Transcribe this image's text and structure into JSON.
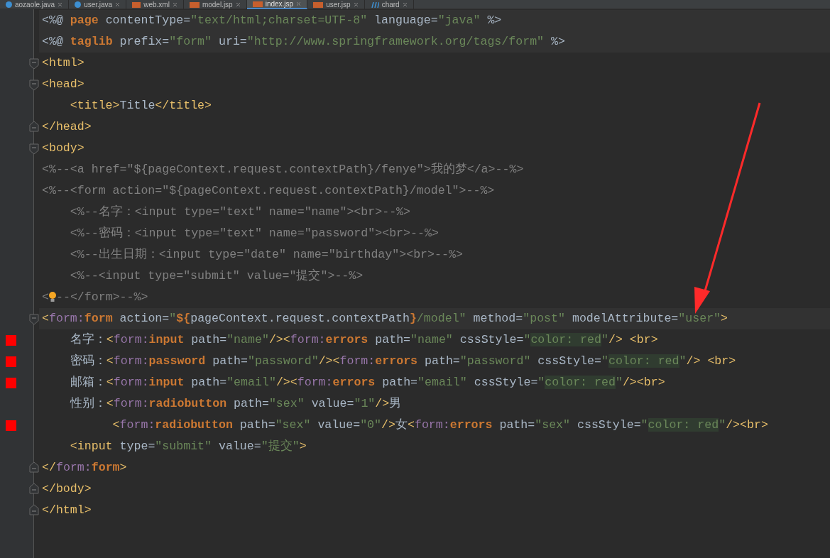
{
  "tabs": [
    {
      "label": "aozaole.java",
      "kind": "java",
      "selected": false
    },
    {
      "label": "user.java",
      "kind": "java",
      "selected": false
    },
    {
      "label": "web.xml",
      "kind": "xml",
      "selected": false
    },
    {
      "label": "model.jsp",
      "kind": "jsp",
      "selected": false
    },
    {
      "label": "index.jsp",
      "kind": "jsp",
      "selected": true
    },
    {
      "label": "user.jsp",
      "kind": "jsp",
      "selected": false
    },
    {
      "label": "chard",
      "kind": "other",
      "selected": false
    }
  ],
  "lines": [
    {
      "segments": [
        {
          "kind": "p",
          "text": "<%@ "
        },
        {
          "kind": "k",
          "text": "page"
        },
        {
          "kind": "p",
          "text": " contentType="
        },
        {
          "kind": "s",
          "text": "\"text/html;charset=UTF-8\""
        },
        {
          "kind": "p",
          "text": " language="
        },
        {
          "kind": "s",
          "text": "\"java\""
        },
        {
          "kind": "p",
          "text": " %>"
        }
      ],
      "highlighted": true,
      "error": false
    },
    {
      "segments": [
        {
          "kind": "p",
          "text": "<%@ "
        },
        {
          "kind": "k",
          "text": "taglib"
        },
        {
          "kind": "p",
          "text": " prefix="
        },
        {
          "kind": "s",
          "text": "\"form\""
        },
        {
          "kind": "p",
          "text": " uri="
        },
        {
          "kind": "s",
          "text": "\"http://www.springframework.org/tags/form\""
        },
        {
          "kind": "p",
          "text": " %>"
        }
      ],
      "highlighted": true,
      "error": false
    },
    {
      "segments": [
        {
          "kind": "t",
          "text": "<html>"
        }
      ],
      "fold_start": true,
      "highlighted": false,
      "error": false
    },
    {
      "segments": [
        {
          "kind": "t",
          "text": "<head>"
        }
      ],
      "fold_start": true,
      "highlighted": false,
      "error": false
    },
    {
      "segments": [
        {
          "kind": "t",
          "text": "    <title>"
        },
        {
          "kind": "p",
          "text": "Title"
        },
        {
          "kind": "t",
          "text": "</title>"
        }
      ],
      "highlighted": false,
      "error": false
    },
    {
      "segments": [
        {
          "kind": "t",
          "text": "</head>"
        }
      ],
      "fold_end": true,
      "highlighted": false,
      "error": false
    },
    {
      "segments": [
        {
          "kind": "t",
          "text": "<body>"
        }
      ],
      "fold_start": true,
      "highlighted": false,
      "error": false
    },
    {
      "segments": [
        {
          "kind": "c",
          "text": "<%--<a href=\"${pageContext.request.contextPath}/fenye\">我的梦</a>--%>"
        }
      ],
      "highlighted": false,
      "error": false
    },
    {
      "segments": [
        {
          "kind": "c",
          "text": "<%--<form action=\"${pageContext.request.contextPath}/model\">--%>"
        }
      ],
      "highlighted": false,
      "error": false
    },
    {
      "segments": [
        {
          "kind": "c",
          "text": "    <%--名字：<input type=\"text\" name=\"name\"><br>--%>"
        }
      ],
      "highlighted": false,
      "error": false
    },
    {
      "segments": [
        {
          "kind": "c",
          "text": "    <%--密码：<input type=\"text\" name=\"password\"><br>--%>"
        }
      ],
      "highlighted": false,
      "error": false
    },
    {
      "segments": [
        {
          "kind": "c",
          "text": "    <%--出生日期：<input type=\"date\" name=\"birthday\"><br>--%>"
        }
      ],
      "highlighted": false,
      "error": false
    },
    {
      "segments": [
        {
          "kind": "c",
          "text": "    <%--<input type=\"submit\" value=\"提交\">--%>"
        }
      ],
      "highlighted": false,
      "error": false
    },
    {
      "segments": [
        {
          "kind": "c",
          "text": "<"
        },
        {
          "kind": "bulb"
        },
        {
          "kind": "c",
          "text": "--</form>--%>"
        }
      ],
      "highlighted": false,
      "error": false
    },
    {
      "segments": [
        {
          "kind": "t",
          "text": "<"
        },
        {
          "kind": "n",
          "text": "form:"
        },
        {
          "kind": "k",
          "text": "form"
        },
        {
          "kind": "p",
          "text": " action="
        },
        {
          "kind": "s",
          "text": "\""
        },
        {
          "kind": "k",
          "text": "${"
        },
        {
          "kind": "p",
          "text": "pageContext.request.contextPath"
        },
        {
          "kind": "k",
          "text": "}"
        },
        {
          "kind": "s",
          "text": "/model\""
        },
        {
          "kind": "p",
          "text": " method="
        },
        {
          "kind": "s",
          "text": "\"post\""
        },
        {
          "kind": "p",
          "text": " modelAttribute="
        },
        {
          "kind": "s",
          "text": "\"user\""
        },
        {
          "kind": "t",
          "text": ">"
        }
      ],
      "fold_start": true,
      "highlighted": true,
      "error": false
    },
    {
      "segments": [
        {
          "kind": "p",
          "text": "    名字："
        },
        {
          "kind": "t",
          "text": "<"
        },
        {
          "kind": "n",
          "text": "form:"
        },
        {
          "kind": "k",
          "text": "input"
        },
        {
          "kind": "p",
          "text": " path="
        },
        {
          "kind": "s",
          "text": "\"name\""
        },
        {
          "kind": "t",
          "text": "/><"
        },
        {
          "kind": "n",
          "text": "form:"
        },
        {
          "kind": "k",
          "text": "errors"
        },
        {
          "kind": "p",
          "text": " path="
        },
        {
          "kind": "s",
          "text": "\"name\""
        },
        {
          "kind": "p",
          "text": " cssStyle="
        },
        {
          "kind": "s",
          "text": "\""
        },
        {
          "kind": "i",
          "text": "color: red"
        },
        {
          "kind": "s",
          "text": "\""
        },
        {
          "kind": "t",
          "text": "/> <br>"
        }
      ],
      "highlighted": false,
      "error": true
    },
    {
      "segments": [
        {
          "kind": "p",
          "text": "    密码："
        },
        {
          "kind": "t",
          "text": "<"
        },
        {
          "kind": "n",
          "text": "form:"
        },
        {
          "kind": "k",
          "text": "password"
        },
        {
          "kind": "p",
          "text": " path="
        },
        {
          "kind": "s",
          "text": "\"password\""
        },
        {
          "kind": "t",
          "text": "/><"
        },
        {
          "kind": "n",
          "text": "form:"
        },
        {
          "kind": "k",
          "text": "errors"
        },
        {
          "kind": "p",
          "text": " path="
        },
        {
          "kind": "s",
          "text": "\"password\""
        },
        {
          "kind": "p",
          "text": " cssStyle="
        },
        {
          "kind": "s",
          "text": "\""
        },
        {
          "kind": "i",
          "text": "color: red"
        },
        {
          "kind": "s",
          "text": "\""
        },
        {
          "kind": "t",
          "text": "/> <br>"
        }
      ],
      "highlighted": false,
      "error": true
    },
    {
      "segments": [
        {
          "kind": "p",
          "text": "    邮箱："
        },
        {
          "kind": "t",
          "text": "<"
        },
        {
          "kind": "n",
          "text": "form:"
        },
        {
          "kind": "k",
          "text": "input"
        },
        {
          "kind": "p",
          "text": " path="
        },
        {
          "kind": "s",
          "text": "\"email\""
        },
        {
          "kind": "t",
          "text": "/><"
        },
        {
          "kind": "n",
          "text": "form:"
        },
        {
          "kind": "k",
          "text": "errors"
        },
        {
          "kind": "p",
          "text": " path="
        },
        {
          "kind": "s",
          "text": "\"email\""
        },
        {
          "kind": "p",
          "text": " cssStyle="
        },
        {
          "kind": "s",
          "text": "\""
        },
        {
          "kind": "i",
          "text": "color: red"
        },
        {
          "kind": "s",
          "text": "\""
        },
        {
          "kind": "t",
          "text": "/><br>"
        }
      ],
      "highlighted": false,
      "error": true
    },
    {
      "segments": [
        {
          "kind": "p",
          "text": "    性别："
        },
        {
          "kind": "t",
          "text": "<"
        },
        {
          "kind": "n",
          "text": "form:"
        },
        {
          "kind": "k",
          "text": "radiobutton"
        },
        {
          "kind": "p",
          "text": " path="
        },
        {
          "kind": "s",
          "text": "\"sex\""
        },
        {
          "kind": "p",
          "text": " value="
        },
        {
          "kind": "s",
          "text": "\"1\""
        },
        {
          "kind": "t",
          "text": "/>"
        },
        {
          "kind": "p",
          "text": "男"
        }
      ],
      "highlighted": false,
      "error": false
    },
    {
      "segments": [
        {
          "kind": "t",
          "text": "          <"
        },
        {
          "kind": "n",
          "text": "form:"
        },
        {
          "kind": "k",
          "text": "radiobutton"
        },
        {
          "kind": "p",
          "text": " path="
        },
        {
          "kind": "s",
          "text": "\"sex\""
        },
        {
          "kind": "p",
          "text": " value="
        },
        {
          "kind": "s",
          "text": "\"0\""
        },
        {
          "kind": "t",
          "text": "/>"
        },
        {
          "kind": "p",
          "text": "女"
        },
        {
          "kind": "t",
          "text": "<"
        },
        {
          "kind": "n",
          "text": "form:"
        },
        {
          "kind": "k",
          "text": "errors"
        },
        {
          "kind": "p",
          "text": " path="
        },
        {
          "kind": "s",
          "text": "\"sex\""
        },
        {
          "kind": "p",
          "text": " cssStyle="
        },
        {
          "kind": "s",
          "text": "\""
        },
        {
          "kind": "i",
          "text": "color: red"
        },
        {
          "kind": "s",
          "text": "\""
        },
        {
          "kind": "t",
          "text": "/><br>"
        }
      ],
      "highlighted": false,
      "error": true
    },
    {
      "segments": [
        {
          "kind": "t",
          "text": "    <input"
        },
        {
          "kind": "p",
          "text": " type="
        },
        {
          "kind": "s",
          "text": "\"submit\""
        },
        {
          "kind": "p",
          "text": " value="
        },
        {
          "kind": "s",
          "text": "\"提交\""
        },
        {
          "kind": "t",
          "text": ">"
        }
      ],
      "highlighted": false,
      "error": false
    },
    {
      "segments": [
        {
          "kind": "t",
          "text": "</"
        },
        {
          "kind": "n",
          "text": "form:"
        },
        {
          "kind": "k",
          "text": "form"
        },
        {
          "kind": "t",
          "text": ">"
        }
      ],
      "fold_end": true,
      "highlighted": false,
      "error": false
    },
    {
      "segments": [
        {
          "kind": "t",
          "text": "</body>"
        }
      ],
      "fold_end": true,
      "highlighted": false,
      "error": false
    },
    {
      "segments": [
        {
          "kind": "t",
          "text": "</html>"
        }
      ],
      "fold_end": true,
      "highlighted": false,
      "error": false
    }
  ]
}
